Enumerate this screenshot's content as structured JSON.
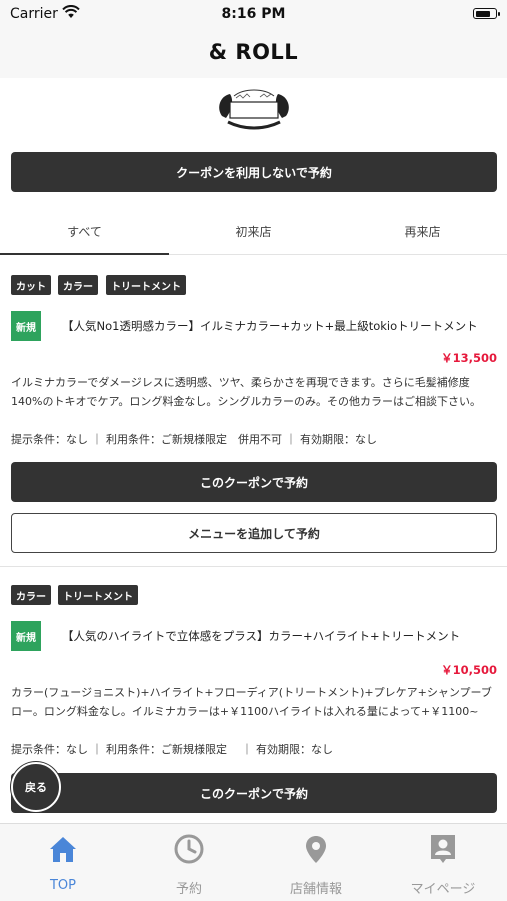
{
  "status_bar": {
    "carrier": "Carrier",
    "time": "8:16 PM"
  },
  "header": {
    "title": "& ROLL"
  },
  "top_button": {
    "label": "クーポンを利用しないで予約"
  },
  "tabs": [
    {
      "label": "すべて",
      "active": true
    },
    {
      "label": "初来店",
      "active": false
    },
    {
      "label": "再来店",
      "active": false
    }
  ],
  "coupons": [
    {
      "tags": [
        "カット",
        "カラー",
        "トリートメント"
      ],
      "badge": "新規",
      "title": "【人気No1透明感カラー】イルミナカラー+カット+最上級tokioトリートメント",
      "price": "￥13,500",
      "description": "イルミナカラーでダメージレスに透明感、ツヤ、柔らかさを再現できます。さらに毛髪補修度140%のトキオでケア。ロング料金なし。シングルカラーのみ。その他カラーはご相談下さい。",
      "conditions": "提示条件：なし ｜ 利用条件：ご新規様限定　併用不可 ｜ 有効期限：なし",
      "reserve_label": "このクーポンで予約",
      "add_menu_label": "メニューを追加して予約"
    },
    {
      "tags": [
        "カラー",
        "トリートメント"
      ],
      "badge": "新規",
      "title": "【人気のハイライトで立体感をプラス】カラー+ハイライト+トリートメント",
      "price": "￥10,500",
      "description": "カラー(フュージョニスト)+ハイライト+フローディア(トリートメント)+プレケア+シャンプーブロー。ロング料金なし。イルミナカラーは+￥1100ハイライトは入れる量によって+￥1100~",
      "conditions": "提示条件：なし ｜ 利用条件：ご新規様限定　 ｜ 有効期限：なし",
      "reserve_label": "このクーポンで予約"
    }
  ],
  "back_button": {
    "label": "戻る"
  },
  "tab_bar": [
    {
      "label": "TOP",
      "icon": "home-icon",
      "active": true
    },
    {
      "label": "予約",
      "icon": "clock-icon",
      "active": false
    },
    {
      "label": "店舗情報",
      "icon": "location-pin-icon",
      "active": false
    },
    {
      "label": "マイページ",
      "icon": "profile-icon",
      "active": false
    }
  ],
  "colors": {
    "accent": "#4a86d8",
    "price": "#e6193c",
    "new_badge": "#2ea35d",
    "dark": "#333333"
  }
}
